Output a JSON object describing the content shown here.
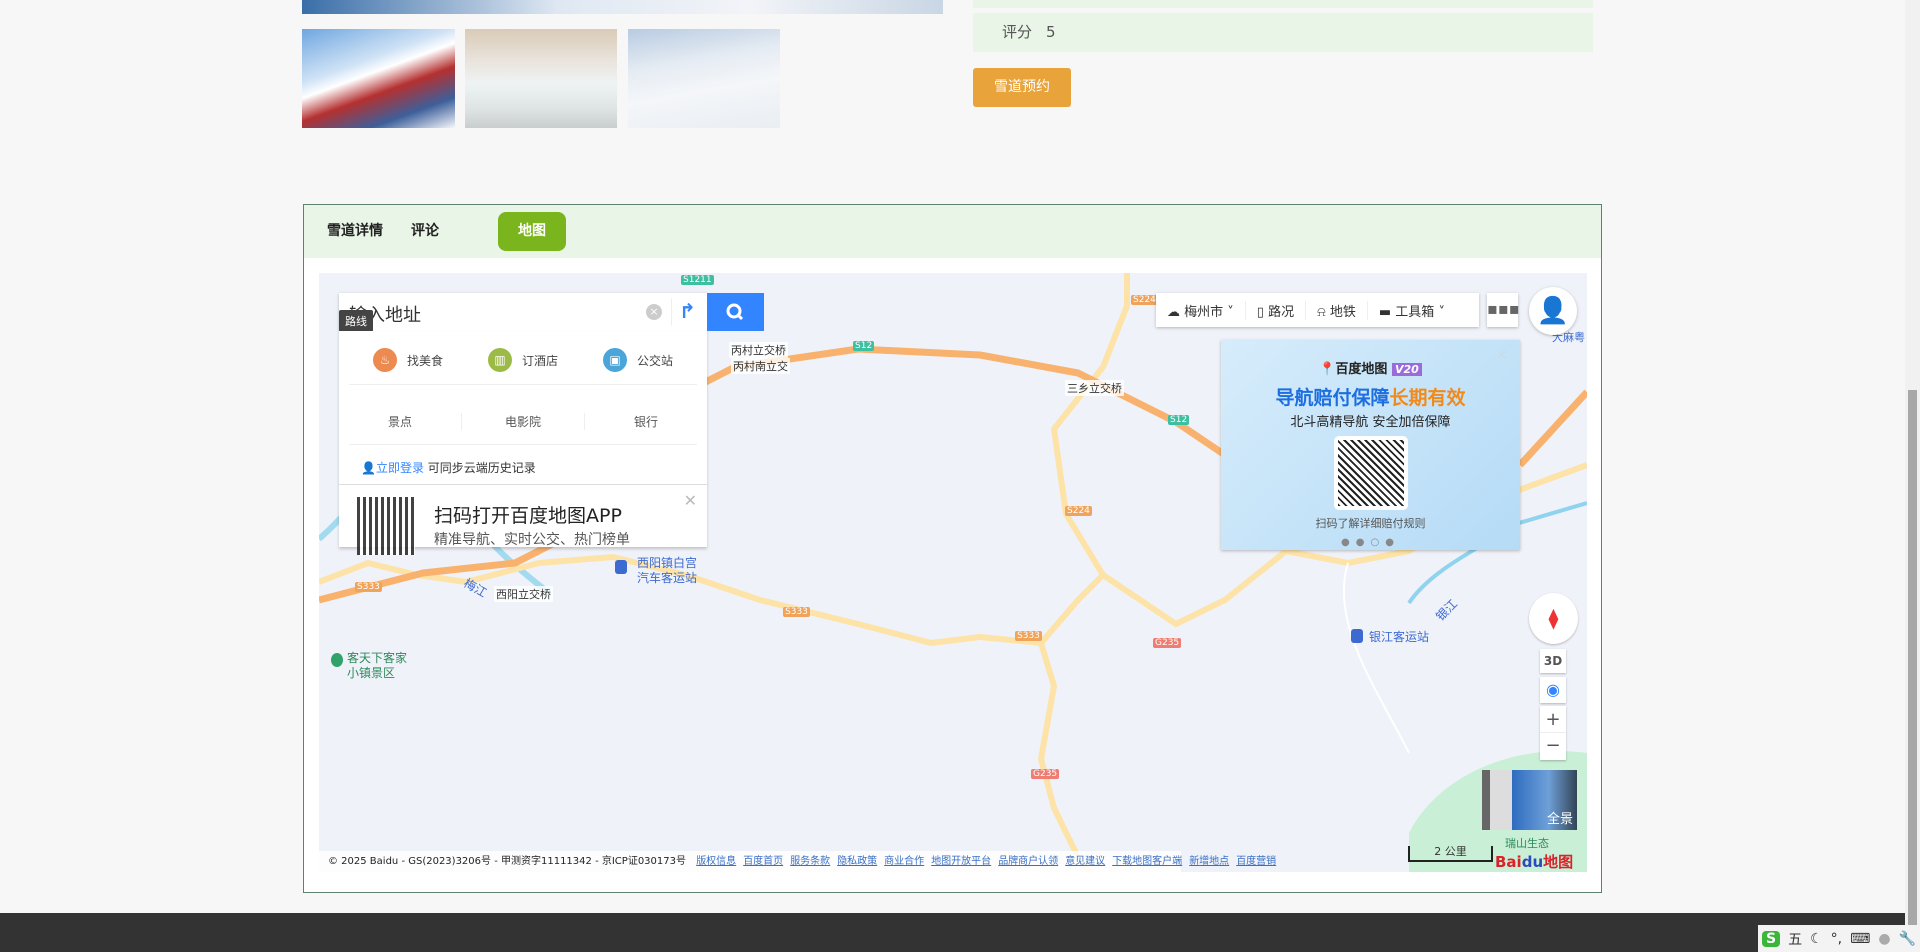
{
  "detail": {
    "rating_label": "评分",
    "rating_value": "5",
    "book_button": "雪道预约"
  },
  "tabs": [
    {
      "label": "雪道详情"
    },
    {
      "label": "评论"
    },
    {
      "label": "地图",
      "active": true
    }
  ],
  "map": {
    "search": {
      "placeholder": "输入地址",
      "tooltip": "路线"
    },
    "quick": [
      {
        "label": "找美食",
        "icon": "food-icon",
        "color": "#ec8a4f"
      },
      {
        "label": "订酒店",
        "icon": "hotel-icon",
        "color": "#9bbb46"
      },
      {
        "label": "公交站",
        "icon": "bus-icon",
        "color": "#4aa5d9"
      }
    ],
    "categories": [
      "景点",
      "电影院",
      "银行"
    ],
    "login": {
      "link": "立即登录",
      "text": "可同步云端历史记录"
    },
    "app_promo": {
      "title": "扫码打开百度地图APP",
      "subtitle": "精准导航、实时公交、热门榜单"
    },
    "toolbar": {
      "city": "梅州市",
      "traffic": "路况",
      "subway": "地铁",
      "toolbox": "工具箱"
    },
    "ad": {
      "brand": "百度地图",
      "version": "V20",
      "headline_blue": "导航赔付保障",
      "headline_orange": "长期有效",
      "sub": "北斗高精导航 安全加倍保障",
      "caption": "扫码了解详细赔付规则",
      "active_dot": 3
    },
    "labels": {
      "l1": "丙村立交桥",
      "l2": "丙村南立交",
      "l3": "三乡立交桥",
      "l4": "西阳立交桥",
      "river1": "梅江",
      "river2": "银江",
      "poi1a": "西阳镇白宫",
      "poi1b": "汽车客运站",
      "poi2": "银江客运站",
      "scenic_a": "客天下客家",
      "scenic_b": "小镇景区",
      "top_right": "大麻粤",
      "eco": "瑞山生态"
    },
    "shields": {
      "s1211": "S1211",
      "s12a": "S12",
      "s12b": "S12",
      "s224a": "S224",
      "s224b": "S224",
      "s333a": "S333",
      "s333b": "S333",
      "s333c": "S333",
      "g235a": "G235",
      "g235b": "G235"
    },
    "controls": {
      "three_d": "3D",
      "zoom_in": "+",
      "zoom_out": "−",
      "panorama": "全景",
      "scale": "2 公里"
    },
    "footer": {
      "copyright": "© 2025 Baidu - GS(2023)3206号 - 甲测资字11111342 - 京ICP证030173号",
      "links": [
        "版权信息",
        "百度首页",
        "服务条款",
        "隐私政策",
        "商业合作",
        "地图开放平台",
        "品牌商户认领",
        "意见建议",
        "下载地图客户端",
        "新增地点",
        "百度营销"
      ]
    },
    "logo": "Baidu地图"
  },
  "tray": {
    "ime": "五"
  }
}
